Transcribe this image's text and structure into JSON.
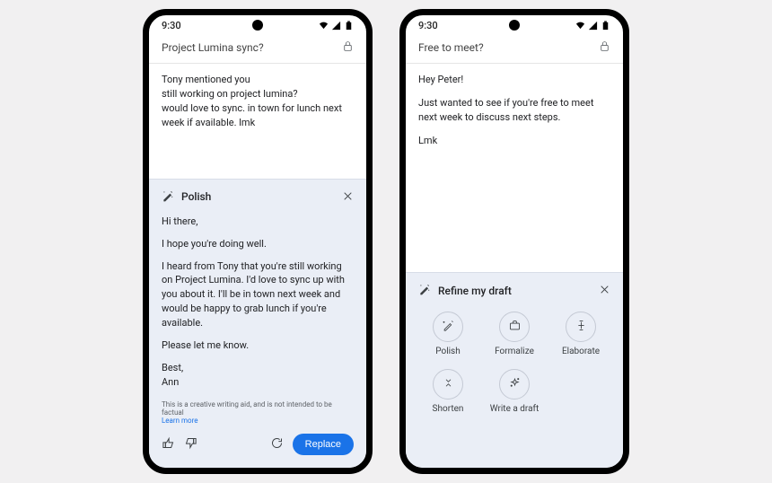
{
  "status": {
    "time": "9:30"
  },
  "left": {
    "subject": "Project Lumina sync?",
    "body": {
      "l1": "Tony mentioned you",
      "l2": "still working on project lumina?",
      "l3": "would love to sync. in town for lunch next week if available. lmk"
    },
    "panel": {
      "title": "Polish",
      "p1": "Hi there,",
      "p2": "I hope you're doing well.",
      "p3": "I heard from Tony that you're still working on Project Lumina. I'd love to sync up with you about it. I'll be in town next week and would be happy to grab lunch if you're available.",
      "p4": "Please let me know.",
      "p5": "Best,",
      "p6": "Ann",
      "disclaimer": "This is a creative writing aid, and is not intended to be factual",
      "learn_more": "Learn more",
      "replace": "Replace"
    }
  },
  "right": {
    "subject": "Free to meet?",
    "body": {
      "l1": "Hey Peter!",
      "l2": "Just wanted to see if you're free to meet next week to discuss next steps.",
      "l3": "Lmk"
    },
    "panel": {
      "title": "Refine my draft",
      "chips": {
        "polish": "Polish",
        "formalize": "Formalize",
        "elaborate": "Elaborate",
        "shorten": "Shorten",
        "write": "Write a draft"
      }
    }
  }
}
